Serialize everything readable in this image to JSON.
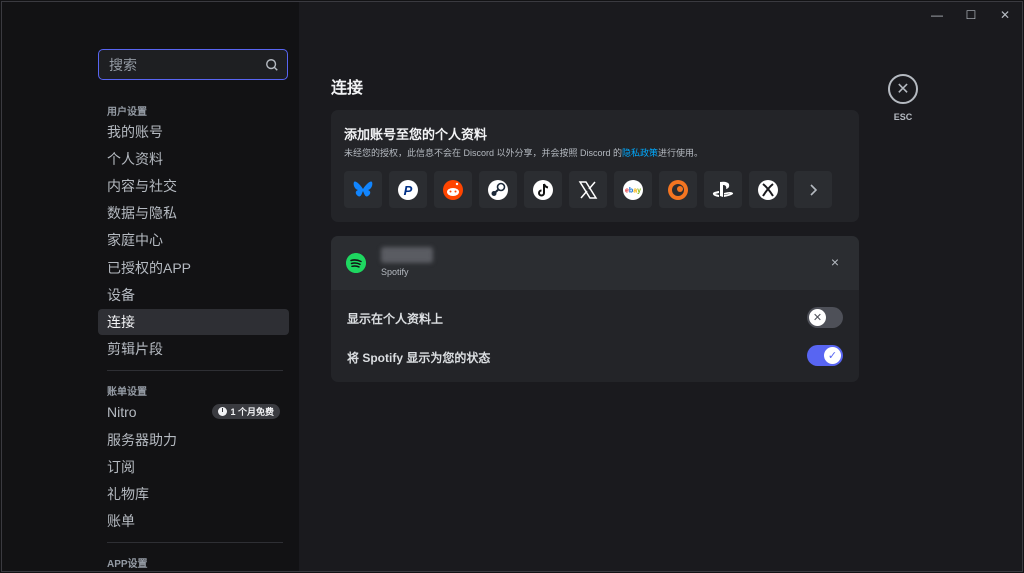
{
  "window_controls": {
    "minimize": "—",
    "maximize": "☐",
    "close": "✕"
  },
  "sidebar": {
    "search_placeholder": "搜索",
    "sections": [
      {
        "title": "用户设置",
        "items": [
          {
            "label": "我的账号"
          },
          {
            "label": "个人资料"
          },
          {
            "label": "内容与社交"
          },
          {
            "label": "数据与隐私"
          },
          {
            "label": "家庭中心"
          },
          {
            "label": "已授权的APP"
          },
          {
            "label": "设备"
          },
          {
            "label": "连接",
            "active": true
          },
          {
            "label": "剪辑片段"
          }
        ]
      },
      {
        "title": "账单设置",
        "items": [
          {
            "label": "Nitro",
            "badge": "1 个月免费"
          },
          {
            "label": "服务器助力"
          },
          {
            "label": "订阅"
          },
          {
            "label": "礼物库"
          },
          {
            "label": "账单"
          }
        ]
      },
      {
        "title": "APP设置",
        "items": []
      }
    ]
  },
  "main": {
    "title": "连接",
    "esc_label": "ESC",
    "add_card": {
      "title": "添加账号至您的个人资料",
      "desc_prefix": "未经您的授权，此信息不会在 Discord 以外分享，并会按照 Discord 的",
      "desc_link": "隐私政策",
      "desc_suffix": "进行使用。",
      "services": [
        "bluesky-icon",
        "paypal-icon",
        "reddit-icon",
        "steam-icon",
        "tiktok-icon",
        "x-icon",
        "ebay-icon",
        "crunchyroll-icon",
        "playstation-icon",
        "xbox-icon",
        "chevron-right-icon"
      ]
    },
    "spotify_card": {
      "service_label": "Spotify",
      "close": "×",
      "rows": [
        {
          "label": "显示在个人资料上",
          "enabled": false
        },
        {
          "label": "将 Spotify 显示为您的状态",
          "enabled": true
        }
      ]
    }
  },
  "colors": {
    "accent": "#5865f2",
    "link": "#00a8fc",
    "spotify": "#1ed760"
  }
}
